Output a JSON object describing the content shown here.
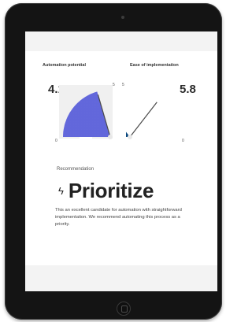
{
  "metrics": {
    "automation": {
      "title": "Automation potential",
      "value_label": "4.1",
      "value": 4.1,
      "min_label": "0",
      "max_label": "5",
      "max": 5,
      "color": "#5a5fd8"
    },
    "ease": {
      "title": "Ease of implementation",
      "value_label": "5.8",
      "value": 5.8,
      "min_label": "0",
      "max_label": "5",
      "max": 10,
      "color": "#0d4a80"
    }
  },
  "recommendation": {
    "label": "Recommendation",
    "icon": "lightning-bolt-icon",
    "title": "Prioritize",
    "description": "This an excellent candidate for automation with straightforward implementation. We recommend automating this process as a priority."
  }
}
